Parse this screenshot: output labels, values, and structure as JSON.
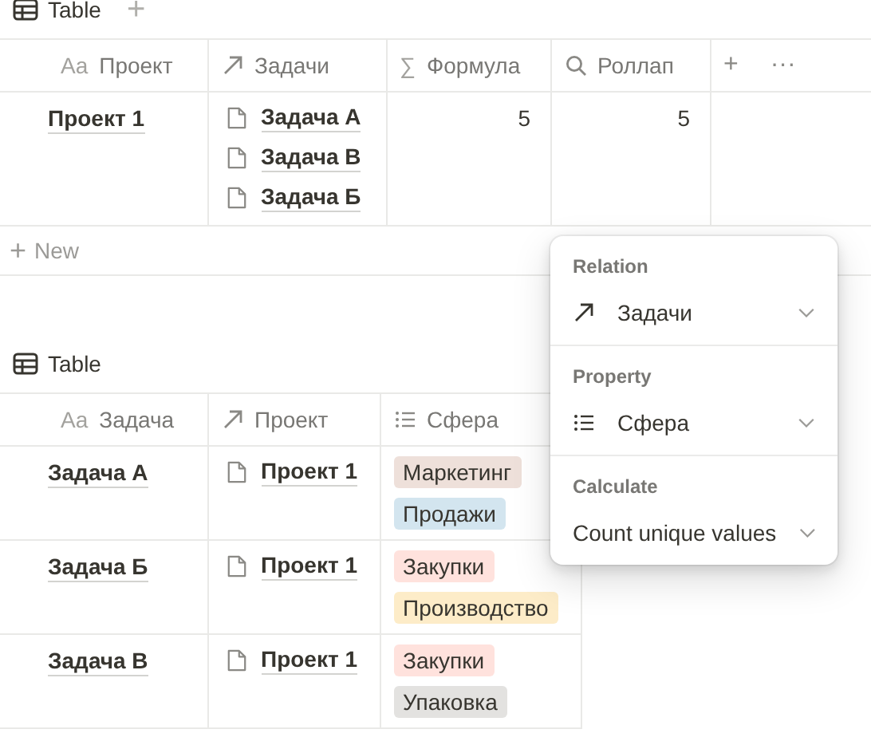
{
  "tables": [
    {
      "title": "Table",
      "add_view": "+",
      "columns": [
        {
          "kind": "title",
          "icon": "Aa",
          "label": "Проект"
        },
        {
          "kind": "relation",
          "label": "Задачи"
        },
        {
          "kind": "formula",
          "icon": "∑",
          "label": "Формула"
        },
        {
          "kind": "rollup",
          "label": "Роллап"
        },
        {
          "kind": "actions",
          "add": "+",
          "more": "···"
        }
      ],
      "rows": [
        [
          {
            "kind": "title",
            "text": "Проект 1"
          },
          {
            "kind": "pages",
            "items": [
              "Задача А",
              "Задача В",
              "Задача Б"
            ]
          },
          {
            "kind": "number",
            "text": "5"
          },
          {
            "kind": "number",
            "text": "5"
          },
          {
            "kind": "empty"
          }
        ]
      ],
      "new_row": {
        "icon": "+",
        "label": "New"
      }
    },
    {
      "title": "Table",
      "columns": [
        {
          "kind": "title",
          "icon": "Aa",
          "label": "Задача"
        },
        {
          "kind": "relation",
          "label": "Проект"
        },
        {
          "kind": "multi",
          "label": "Сфера"
        }
      ],
      "rows": [
        [
          {
            "kind": "title",
            "text": "Задача А"
          },
          {
            "kind": "pages",
            "items": [
              "Проект 1"
            ]
          },
          {
            "kind": "tags",
            "items": [
              {
                "text": "Маркетинг",
                "color": "#eee0da"
              },
              {
                "text": "Продажи",
                "color": "#d3e5ef"
              }
            ]
          }
        ],
        [
          {
            "kind": "title",
            "text": "Задача Б"
          },
          {
            "kind": "pages",
            "items": [
              "Проект 1"
            ]
          },
          {
            "kind": "tags",
            "items": [
              {
                "text": "Закупки",
                "color": "#ffe2dd"
              },
              {
                "text": "Производство",
                "color": "#fdecc8"
              }
            ]
          }
        ],
        [
          {
            "kind": "title",
            "text": "Задача В"
          },
          {
            "kind": "pages",
            "items": [
              "Проект 1"
            ]
          },
          {
            "kind": "tags",
            "items": [
              {
                "text": "Закупки",
                "color": "#ffe2dd"
              },
              {
                "text": "Упаковка",
                "color": "#e3e2e0"
              }
            ]
          }
        ]
      ]
    }
  ],
  "popup": {
    "sections": [
      {
        "kind": "relation",
        "label": "Relation",
        "value": "Задачи"
      },
      {
        "kind": "property",
        "label": "Property",
        "value": "Сфера"
      },
      {
        "kind": "calculate",
        "label": "Calculate",
        "value": "Count unique values"
      }
    ]
  }
}
